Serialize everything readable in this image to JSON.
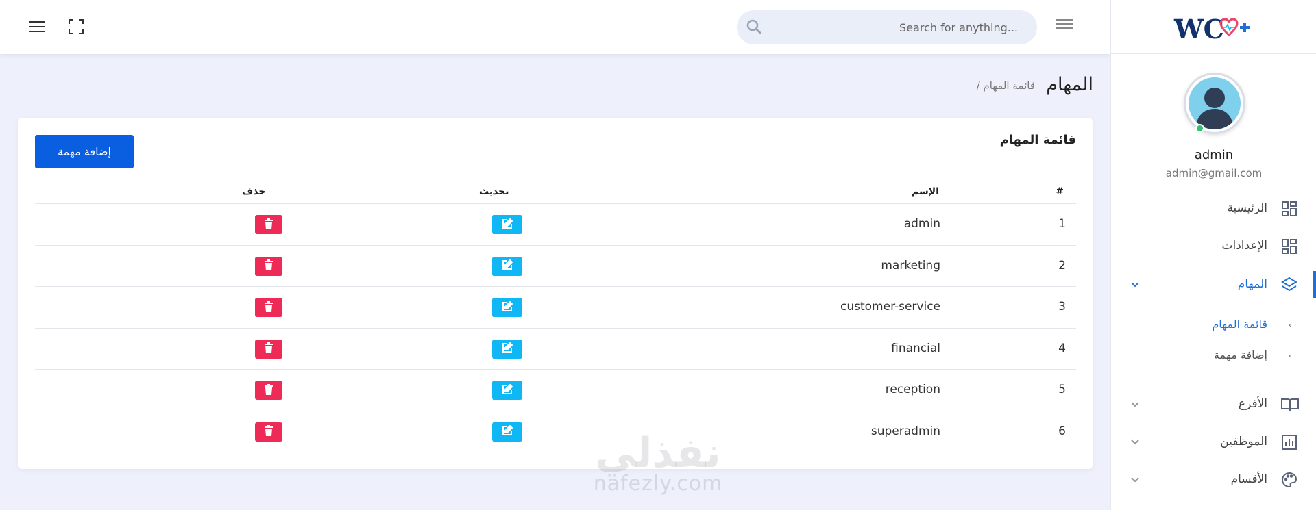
{
  "header": {
    "search_placeholder": "Search for anything...",
    "icons": [
      "hamburger-menu-icon",
      "fullscreen-icon",
      "search-icon",
      "align-right-icon"
    ]
  },
  "sidebar": {
    "brand": "WC",
    "user": {
      "name": "admin",
      "email": "admin@gmail.com"
    },
    "items": [
      {
        "label": "الرئيسية",
        "icon": "dashboard-icon"
      },
      {
        "label": "الإعدادات",
        "icon": "dashboard-icon"
      },
      {
        "label": "المهام",
        "icon": "layers-icon",
        "active": true
      },
      {
        "label": "الأفرع",
        "icon": "book-icon"
      },
      {
        "label": "الموظفين",
        "icon": "bar-chart-icon"
      },
      {
        "label": "الأقسام",
        "icon": "palette-icon"
      }
    ],
    "sub_items": [
      {
        "label": "قائمة المهام",
        "active": true
      },
      {
        "label": "إضافة مهمة"
      }
    ]
  },
  "page": {
    "title": "المهام",
    "breadcrumb": "/ قائمة المهام"
  },
  "card": {
    "title": "قائمة المهام",
    "add_button": "إضافة مهمة"
  },
  "table": {
    "columns": {
      "num": "#",
      "name": "الإسم",
      "edit": "تحديث",
      "delete": "حذف"
    },
    "rows": [
      {
        "num": "1",
        "name": "admin"
      },
      {
        "num": "2",
        "name": "marketing"
      },
      {
        "num": "3",
        "name": "customer-service"
      },
      {
        "num": "4",
        "name": "financial"
      },
      {
        "num": "5",
        "name": "reception"
      },
      {
        "num": "6",
        "name": "superadmin"
      }
    ]
  },
  "watermark": {
    "arabic": "نفذلي",
    "latin": "nafezly.com"
  },
  "colors": {
    "primary": "#0a5fe0",
    "edit": "#0fb7f5",
    "delete": "#ee2b56",
    "active": "#1f6fd6",
    "background": "#eef1fb"
  }
}
